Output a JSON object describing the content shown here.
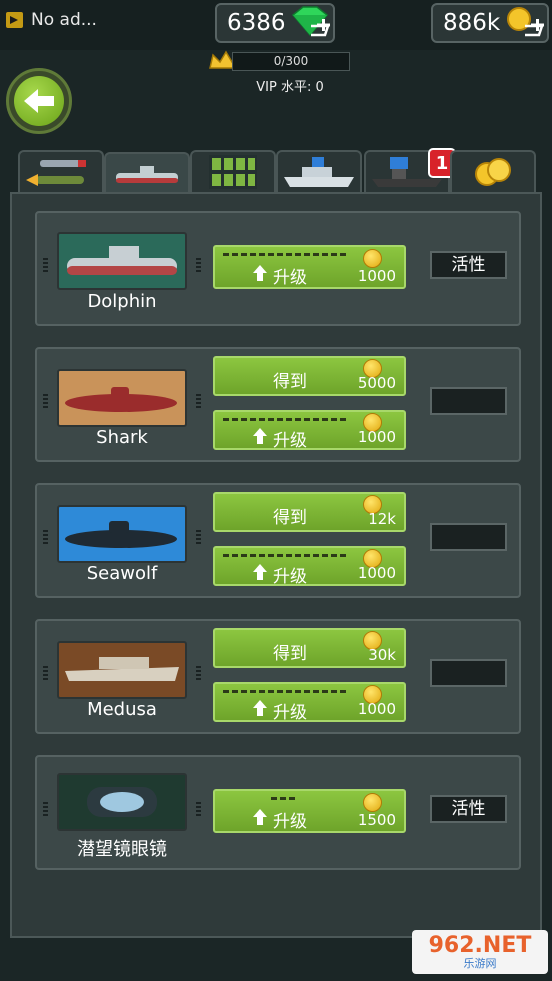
{
  "topbar": {
    "no_ads_label": "No ad...",
    "gems": "6386",
    "coins": "886k",
    "vip_progress": "0/300",
    "vip_level": "VIP 水平: 0"
  },
  "tabs": [
    {
      "icon": "torpedo-icon"
    },
    {
      "icon": "submarine-icon",
      "active": true
    },
    {
      "icon": "crew-grid-icon"
    },
    {
      "icon": "warship-icon"
    },
    {
      "icon": "carrier-icon",
      "badge": "1"
    },
    {
      "icon": "coins-icon"
    }
  ],
  "vehicles": [
    {
      "name": "Dolphin",
      "upgrade_label": "升级",
      "upgrade_price": "1000",
      "state": "活性"
    },
    {
      "name": "Shark",
      "get_label": "得到",
      "get_price": "5000",
      "upgrade_label": "升级",
      "upgrade_price": "1000",
      "state": ""
    },
    {
      "name": "Seawolf",
      "get_label": "得到",
      "get_price": "12k",
      "upgrade_label": "升级",
      "upgrade_price": "1000",
      "state": ""
    },
    {
      "name": "Medusa",
      "get_label": "得到",
      "get_price": "30k",
      "upgrade_label": "升级",
      "upgrade_price": "1000",
      "state": ""
    },
    {
      "name": "潜望镜眼镜",
      "upgrade_label": "升级",
      "upgrade_price": "1500",
      "state": "活性"
    }
  ],
  "watermark": {
    "text": "962.NET",
    "sub": "乐游网"
  }
}
